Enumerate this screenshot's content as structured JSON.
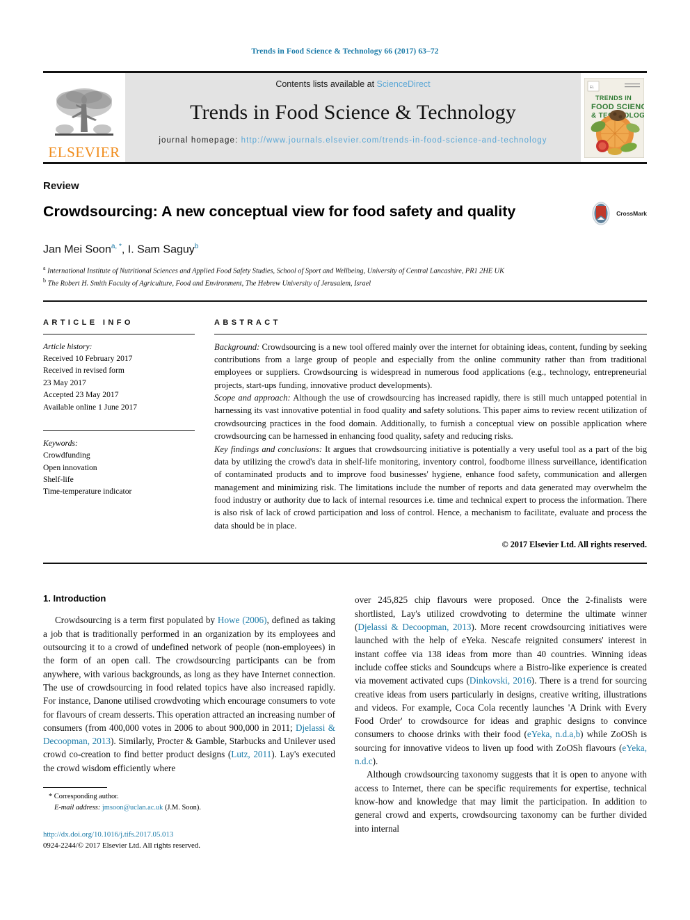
{
  "running_head": "Trends in Food Science & Technology 66 (2017) 63–72",
  "masthead": {
    "contents_prefix": "Contents lists available at ",
    "sciencedirect": "ScienceDirect",
    "journal_title": "Trends in Food Science & Technology",
    "homepage_prefix": "journal homepage: ",
    "homepage_url": "http://www.journals.elsevier.com/trends-in-food-science-and-technology",
    "publisher_name": "ELSEVIER",
    "cover_title_line1": "TRENDS IN",
    "cover_title_line2": "FOOD SCIENCE",
    "cover_title_line3": "& TECHNOLOGY"
  },
  "article": {
    "type": "Review",
    "title": "Crowdsourcing: A new conceptual view for food safety and quality",
    "crossmark_label": "CrossMark",
    "authors_text": "Jan Mei Soon ",
    "author1": "Jan Mei Soon",
    "author1_sup": "a, *",
    "author2": ", I. Sam Saguy",
    "author2_sup": "b",
    "affiliation_a_sup": "a",
    "affiliation_a": "International Institute of Nutritional Sciences and Applied Food Safety Studies, School of Sport and Wellbeing, University of Central Lancashire, PR1 2HE UK",
    "affiliation_b_sup": "b",
    "affiliation_b": "The Robert H. Smith Faculty of Agriculture, Food and Environment, The Hebrew University of Jerusalem, Israel"
  },
  "article_info": {
    "heading": "ARTICLE INFO",
    "history_label": "Article history:",
    "history": [
      "Received 10 February 2017",
      "Received in revised form",
      "23 May 2017",
      "Accepted 23 May 2017",
      "Available online 1 June 2017"
    ],
    "keywords_label": "Keywords:",
    "keywords": [
      "Crowdfunding",
      "Open innovation",
      "Shelf-life",
      "Time-temperature indicator"
    ]
  },
  "abstract": {
    "heading": "ABSTRACT",
    "background_label": "Background:",
    "background_text": " Crowdsourcing is a new tool offered mainly over the internet for obtaining ideas, content, funding by seeking contributions from a large group of people and especially from the online community rather than from traditional employees or suppliers. Crowdsourcing is widespread in numerous food applications (e.g., technology, entrepreneurial projects, start-ups funding, innovative product developments).",
    "scope_label": "Scope and approach:",
    "scope_text": " Although the use of crowdsourcing has increased rapidly, there is still much untapped potential in harnessing its vast innovative potential in food quality and safety solutions. This paper aims to review recent utilization of crowdsourcing practices in the food domain. Additionally, to furnish a conceptual view on possible application where crowdsourcing can be harnessed in enhancing food quality, safety and reducing risks.",
    "findings_label": "Key findings and conclusions:",
    "findings_text": " It argues that crowdsourcing initiative is potentially a very useful tool as a part of the big data by utilizing the crowd's data in shelf-life monitoring, inventory control, foodborne illness surveillance, identification of contaminated products and to improve food businesses' hygiene, enhance food safety, communication and allergen management and minimizing risk. The limitations include the number of reports and data generated may overwhelm the food industry or authority due to lack of internal resources i.e. time and technical expert to process the information. There is also risk of lack of crowd participation and loss of control. Hence, a mechanism to facilitate, evaluate and process the data should be in place.",
    "copyright": "© 2017 Elsevier Ltd. All rights reserved."
  },
  "body": {
    "section_heading": "1. Introduction",
    "left_p1_a": "Crowdsourcing is a term first populated by ",
    "left_p1_ref1": "Howe (2006)",
    "left_p1_b": ", defined as taking a job that is traditionally performed in an organization by its employees and outsourcing it to a crowd of undefined network of people (non-employees) in the form of an open call. The crowdsourcing participants can be from anywhere, with various backgrounds, as long as they have Internet connection. The use of crowdsourcing in food related topics have also increased rapidly. For instance, Danone utilised crowdvoting which encourage consumers to vote for flavours of cream desserts. This operation attracted an increasing number of consumers (from 400,000 votes in 2006 to about 900,000 in 2011; ",
    "left_p1_ref2": "Djelassi & Decoopman, 2013",
    "left_p1_c": "). Similarly, Procter & Gamble, Starbucks and Unilever used crowd co-creation to find better product designs (",
    "left_p1_ref3": "Lutz, 2011",
    "left_p1_d": "). Lay's executed the crowd wisdom efficiently where",
    "right_p1_a": "over 245,825 chip flavours were proposed. Once the 2-finalists were shortlisted, Lay's utilized crowdvoting to determine the ultimate winner (",
    "right_p1_ref1": "Djelassi & Decoopman, 2013",
    "right_p1_b": "). More recent crowdsourcing initiatives were launched with the help of eYeka. Nescafe reignited consumers' interest in instant coffee via 138 ideas from more than 40 countries. Winning ideas include coffee sticks and Soundcups where a Bistro-like experience is created via movement activated cups (",
    "right_p1_ref2": "Dinkovski, 2016",
    "right_p1_c": "). There is a trend for sourcing creative ideas from users particularly in designs, creative writing, illustrations and videos. For example, Coca Cola recently launches 'A Drink with Every Food Order' to crowdsource for ideas and graphic designs to convince consumers to choose drinks with their food (",
    "right_p1_ref3": "eYeka, n.d.a,b",
    "right_p1_d": ") while ZoOSh is sourcing for innovative videos to liven up food with ZoOSh flavours (",
    "right_p1_ref4": "eYeka, n.d.c",
    "right_p1_e": ").",
    "right_p2": "Although crowdsourcing taxonomy suggests that it is open to anyone with access to Internet, there can be specific requirements for expertise, technical know-how and knowledge that may limit the participation. In addition to general crowd and experts, crowdsourcing taxonomy can be further divided into internal"
  },
  "footnotes": {
    "corresponding_marker": "*",
    "corresponding_label": " Corresponding author.",
    "email_label": "E-mail address:",
    "email": " jmsoon@uclan.ac.uk",
    "email_owner": " (J.M. Soon).",
    "doi": "http://dx.doi.org/10.1016/j.tifs.2017.05.013",
    "issn_line": "0924-2244/© 2017 Elsevier Ltd. All rights reserved."
  },
  "colors": {
    "link": "#1c7ba8",
    "masthead_link": "#5ba7d6",
    "elsevier_orange": "#f08c1c",
    "masthead_bg": "#e3e3e3"
  }
}
